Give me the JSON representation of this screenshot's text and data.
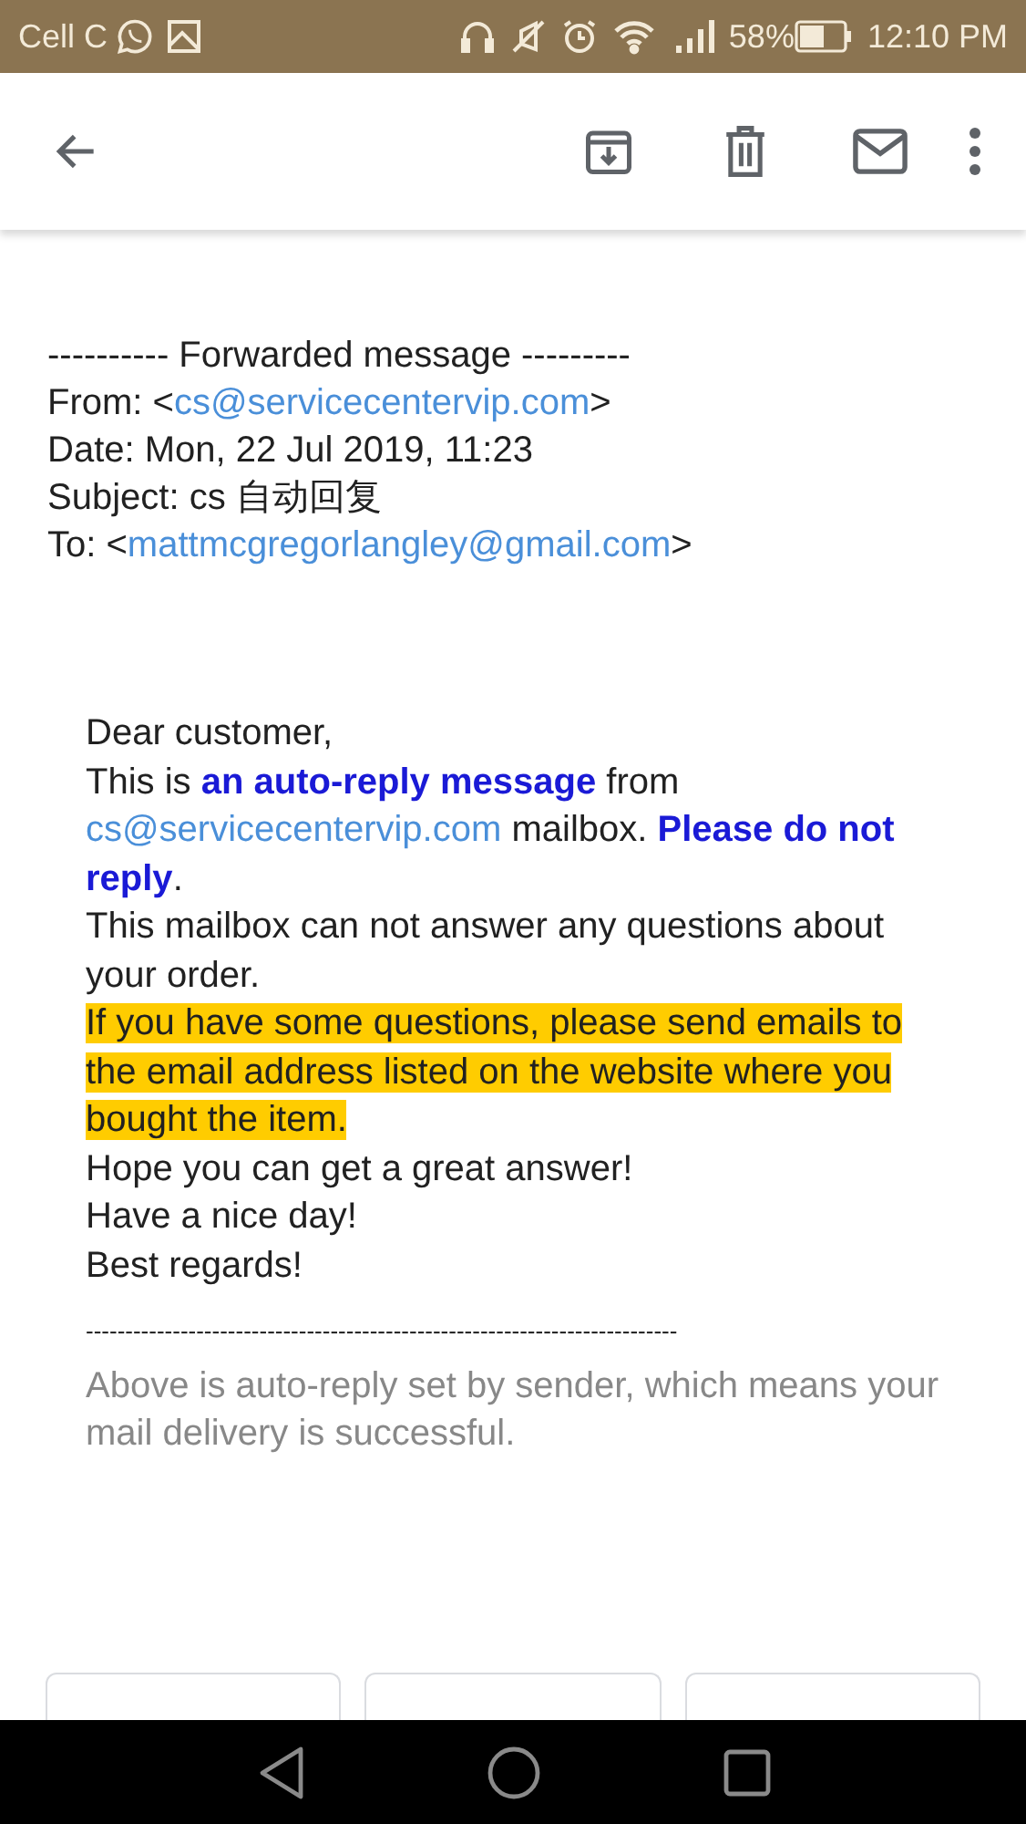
{
  "status_bar": {
    "carrier": "Cell C",
    "battery": "58%",
    "time": "12:10 PM"
  },
  "header_lines": [
    {
      "parts": [
        {
          "kind": "text",
          "text": "---------- Forwarded message ---------"
        }
      ]
    },
    {
      "parts": [
        {
          "kind": "text",
          "text": "From: <"
        },
        {
          "kind": "link",
          "text": "cs@servicecentervip.com"
        },
        {
          "kind": "text",
          "text": ">"
        }
      ]
    },
    {
      "parts": [
        {
          "kind": "text",
          "text": "Date: Mon, 22 Jul 2019, 11:23"
        }
      ]
    },
    {
      "parts": [
        {
          "kind": "text",
          "text": "Subject: cs 自动回复"
        }
      ]
    },
    {
      "parts": [
        {
          "kind": "text",
          "text": "To: <"
        },
        {
          "kind": "link",
          "text": "mattmcgregorlangley@gmail.com"
        },
        {
          "kind": "text",
          "text": ">"
        }
      ]
    }
  ],
  "body": [
    {
      "highlighted": false,
      "parts": [
        {
          "kind": "text",
          "text": "Dear customer,"
        }
      ]
    },
    {
      "highlighted": false,
      "parts": [
        {
          "kind": "text",
          "text": "This is **an auto-reply message** from "
        },
        {
          "kind": "link",
          "text": "cs@servicecentervip.com"
        },
        {
          "kind": "text",
          "text": " mailbox. **Please do not reply**."
        }
      ]
    },
    {
      "highlighted": false,
      "parts": [
        {
          "kind": "text",
          "text": "This mailbox can not answer any questions about your order."
        }
      ]
    },
    {
      "highlighted": true,
      "parts": [
        {
          "kind": "text",
          "text": "If you have some questions, please send emails to the email address listed on the website where you bought the item."
        }
      ]
    },
    {
      "highlighted": false,
      "parts": [
        {
          "kind": "text",
          "text": "Hope you can get a great answer!"
        }
      ]
    },
    {
      "highlighted": false,
      "parts": [
        {
          "kind": "text",
          "text": "Have a nice day!"
        }
      ]
    },
    {
      "highlighted": false,
      "parts": [
        {
          "kind": "text",
          "text": "Best regards!"
        }
      ]
    }
  ],
  "separator": "---------------------------------------------------------------------------",
  "footer_note": "Above is auto-reply set by sender, which means your mail delivery is successful."
}
